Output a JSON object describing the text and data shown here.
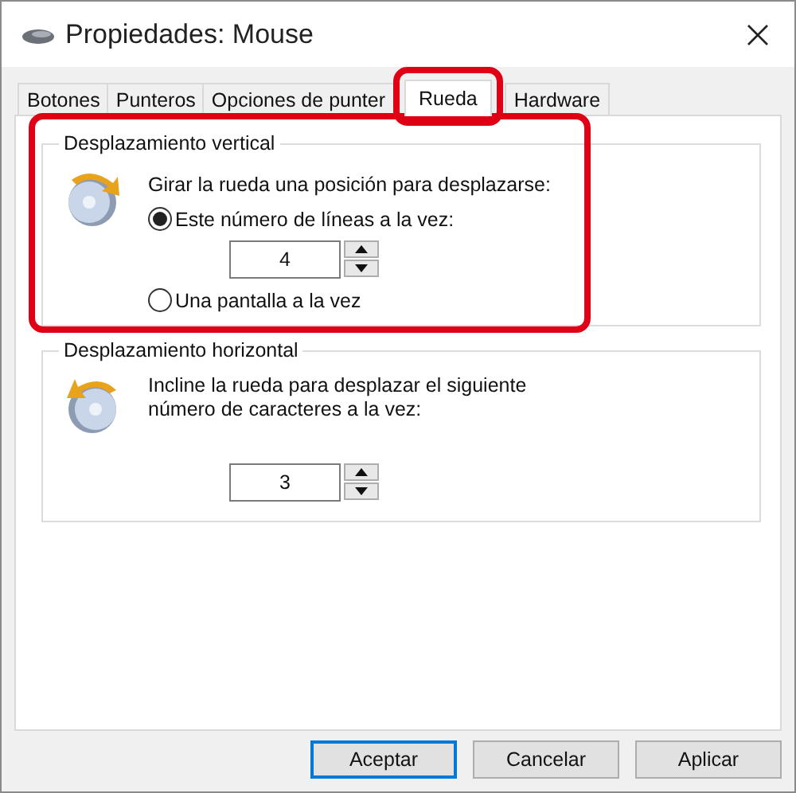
{
  "window": {
    "title": "Propiedades: Mouse"
  },
  "tabs": [
    {
      "label": "Botones",
      "selected": false,
      "highlighted": false
    },
    {
      "label": "Punteros",
      "selected": false,
      "highlighted": false
    },
    {
      "label": "Opciones de punter",
      "selected": false,
      "highlighted": false
    },
    {
      "label": "Rueda",
      "selected": true,
      "highlighted": true
    },
    {
      "label": "Hardware",
      "selected": false,
      "highlighted": false
    }
  ],
  "groups": [
    {
      "kind": "vertical",
      "title": "Desplazamiento vertical",
      "highlighted": true,
      "items": [
        {
          "kind": "text",
          "text": "Girar la rueda una posición para desplazarse:"
        },
        {
          "kind": "radio",
          "label": "Este número de líneas a la vez:",
          "selected": true
        },
        {
          "kind": "spinner",
          "value": "4"
        },
        {
          "kind": "radio",
          "label": "Una pantalla a la vez",
          "selected": false
        }
      ]
    },
    {
      "kind": "horizontal",
      "title": "Desplazamiento horizontal",
      "highlighted": false,
      "items": [
        {
          "kind": "text",
          "text": "Incline la rueda para desplazar el siguiente número de caracteres a la vez:"
        },
        {
          "kind": "spinner",
          "value": "3"
        }
      ]
    }
  ],
  "buttons": [
    {
      "label": "Aceptar",
      "default": true
    },
    {
      "label": "Cancelar",
      "default": false
    },
    {
      "label": "Aplicar",
      "default": false
    }
  ]
}
